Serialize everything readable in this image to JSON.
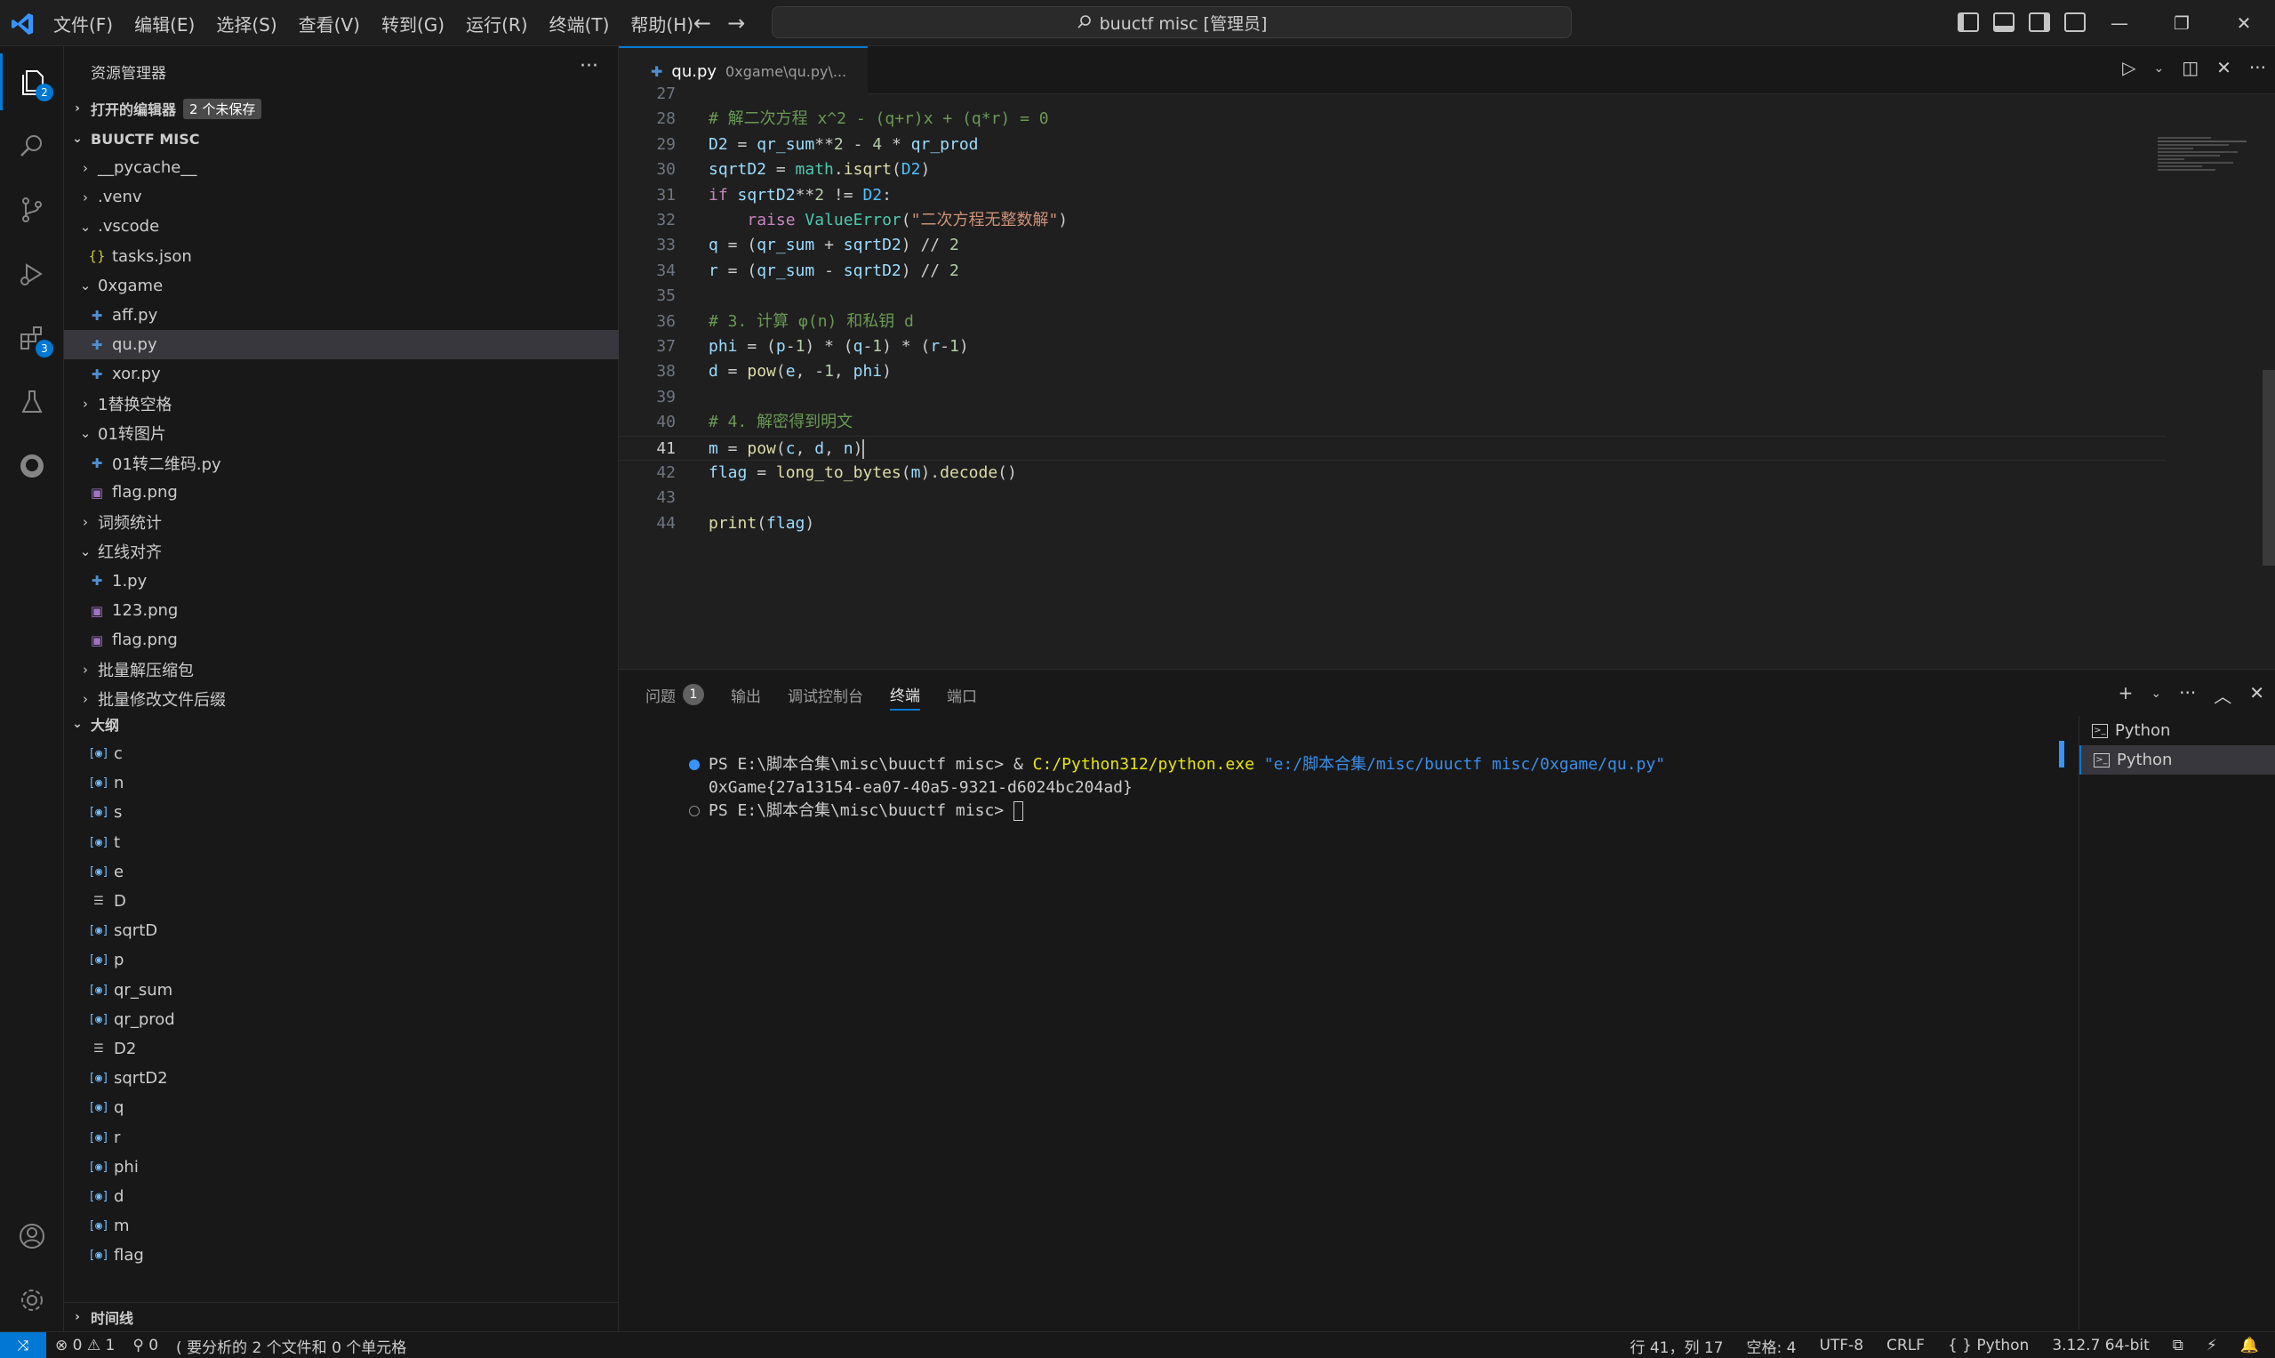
{
  "titlebar": {
    "menu": [
      "文件(F)",
      "编辑(E)",
      "选择(S)",
      "查看(V)",
      "转到(G)",
      "运行(R)",
      "终端(T)",
      "帮助(H)"
    ],
    "search_text": "buuctf misc [管理员]",
    "nav_back": "←",
    "nav_forward": "→"
  },
  "activity": {
    "explorer_badge": "2",
    "extensions_badge": "3"
  },
  "sidebar": {
    "title": "资源管理器",
    "open_editors_label": "打开的编辑器",
    "unsaved_badge": "2 个未保存",
    "workspace_label": "BUUCTF MISC",
    "outline_label": "大纲",
    "timeline_label": "时间线",
    "tree": [
      {
        "label": "__pycache__",
        "kind": "folder",
        "chevron": "›"
      },
      {
        "label": ".venv",
        "kind": "folder",
        "chevron": "›"
      },
      {
        "label": ".vscode",
        "kind": "folder",
        "chevron": "⌄"
      },
      {
        "label": "tasks.json",
        "kind": "json",
        "icon": "{}"
      },
      {
        "label": "0xgame",
        "kind": "folder",
        "chevron": "⌄"
      },
      {
        "label": "aff.py",
        "kind": "py",
        "icon": "✚"
      },
      {
        "label": "qu.py",
        "kind": "py",
        "icon": "✚"
      },
      {
        "label": "xor.py",
        "kind": "py",
        "icon": "✚"
      },
      {
        "label": "1替换空格",
        "kind": "folder",
        "chevron": "›"
      },
      {
        "label": "01转图片",
        "kind": "folder",
        "chevron": "⌄"
      },
      {
        "label": "01转二维码.py",
        "kind": "py",
        "icon": "✚"
      },
      {
        "label": "flag.png",
        "kind": "png",
        "icon": "▣"
      },
      {
        "label": "词频统计",
        "kind": "folder",
        "chevron": "›"
      },
      {
        "label": "红线对齐",
        "kind": "folder",
        "chevron": "⌄"
      },
      {
        "label": "1.py",
        "kind": "py",
        "icon": "✚"
      },
      {
        "label": "123.png",
        "kind": "png",
        "icon": "▣"
      },
      {
        "label": "flag.png",
        "kind": "png",
        "icon": "▣"
      },
      {
        "label": "批量解压缩包",
        "kind": "folder",
        "chevron": "›"
      },
      {
        "label": "批量修改文件后缀",
        "kind": "folder",
        "chevron": "›"
      }
    ],
    "outline": [
      {
        "label": "c",
        "icon": "[◉]"
      },
      {
        "label": "n",
        "icon": "[◉]"
      },
      {
        "label": "s",
        "icon": "[◉]"
      },
      {
        "label": "t",
        "icon": "[◉]"
      },
      {
        "label": "e",
        "icon": "[◉]"
      },
      {
        "label": "D",
        "icon": "☰"
      },
      {
        "label": "sqrtD",
        "icon": "[◉]"
      },
      {
        "label": "p",
        "icon": "[◉]"
      },
      {
        "label": "qr_sum",
        "icon": "[◉]"
      },
      {
        "label": "qr_prod",
        "icon": "[◉]"
      },
      {
        "label": "D2",
        "icon": "☰"
      },
      {
        "label": "sqrtD2",
        "icon": "[◉]"
      },
      {
        "label": "q",
        "icon": "[◉]"
      },
      {
        "label": "r",
        "icon": "[◉]"
      },
      {
        "label": "phi",
        "icon": "[◉]"
      },
      {
        "label": "d",
        "icon": "[◉]"
      },
      {
        "label": "m",
        "icon": "[◉]"
      },
      {
        "label": "flag",
        "icon": "[◉]"
      }
    ]
  },
  "editor": {
    "tab_name": "qu.py",
    "tab_path": "0xgame\\qu.py\\...",
    "lines": [
      {
        "n": "27",
        "html": ""
      },
      {
        "n": "28",
        "html": "<span class=\"cm\"># 解二次方程 x^2 - (q+r)x + (q*r) = 0</span>"
      },
      {
        "n": "29",
        "html": "<span class=\"vr\">D2</span> = <span class=\"vr\">qr_sum</span>**<span class=\"nm\">2</span> - <span class=\"nm\">4</span> * <span class=\"vr\">qr_prod</span>"
      },
      {
        "n": "30",
        "html": "<span class=\"vr\">sqrtD2</span> = <span class=\"ty\">math</span>.<span class=\"fn\">isqrt</span>(<span class=\"cn\">D2</span>)"
      },
      {
        "n": "31",
        "html": "<span class=\"kw\">if</span> <span class=\"vr\">sqrtD2</span>**<span class=\"nm\">2</span> != <span class=\"cn\">D2</span>:"
      },
      {
        "n": "32",
        "html": "    <span class=\"kw\">raise</span> <span class=\"ty\">ValueError</span>(<span class=\"st\">\"二次方程无整数解\"</span>)"
      },
      {
        "n": "33",
        "html": "<span class=\"vr\">q</span> = (<span class=\"vr\">qr_sum</span> + <span class=\"vr\">sqrtD2</span>) // <span class=\"nm\">2</span>"
      },
      {
        "n": "34",
        "html": "<span class=\"vr\">r</span> = (<span class=\"vr\">qr_sum</span> - <span class=\"vr\">sqrtD2</span>) // <span class=\"nm\">2</span>"
      },
      {
        "n": "35",
        "html": ""
      },
      {
        "n": "36",
        "html": "<span class=\"cm\"># 3. 计算 φ(n) 和私钥 d</span>"
      },
      {
        "n": "37",
        "html": "<span class=\"vr\">phi</span> = (<span class=\"vr\">p</span>-<span class=\"nm\">1</span>) * (<span class=\"vr\">q</span>-<span class=\"nm\">1</span>) * (<span class=\"vr\">r</span>-<span class=\"nm\">1</span>)"
      },
      {
        "n": "38",
        "html": "<span class=\"vr\">d</span> = <span class=\"fn\">pow</span>(<span class=\"vr\">e</span>, -<span class=\"nm\">1</span>, <span class=\"vr\">phi</span>)"
      },
      {
        "n": "39",
        "html": ""
      },
      {
        "n": "40",
        "html": "<span class=\"cm\"># 4. 解密得到明文</span>"
      },
      {
        "n": "41",
        "html": "<span class=\"vr\">m</span> = <span class=\"fn\">pow</span>(<span class=\"vr\">c</span>, <span class=\"vr\">d</span>, <span class=\"vr\">n</span>)<span class=\"caret\"></span>"
      },
      {
        "n": "42",
        "html": "<span class=\"vr\">flag</span> = <span class=\"fn\">long_to_bytes</span>(<span class=\"vr\">m</span>).<span class=\"fn\">decode</span>()"
      },
      {
        "n": "43",
        "html": ""
      },
      {
        "n": "44",
        "html": "<span class=\"fn\">print</span>(<span class=\"vr\">flag</span>)"
      }
    ],
    "current_line": "41"
  },
  "panel": {
    "tabs": [
      "问题",
      "输出",
      "调试控制台",
      "终端",
      "端口"
    ],
    "problems_count": "1",
    "active_tab": "终端",
    "terminal_prompt": "PS E:\\脚本合集\\misc\\buuctf misc>",
    "terminal_cmd_amp": "&",
    "terminal_exe": "C:/Python312/python.exe",
    "terminal_arg": "\"e:/脚本合集/misc/buuctf misc/0xgame/qu.py\"",
    "terminal_output": "0xGame{27a13154-ea07-40a5-9321-d6024bc204ad}",
    "terminal_list": [
      "Python",
      "Python"
    ]
  },
  "statusbar": {
    "remote": "⤨",
    "errors": "⊗ 0",
    "warnings": "⚠ 1",
    "ports": "⚲ 0",
    "analysis": "要分析的 2 个文件和 0 个单元格",
    "position": "行 41，列 17",
    "spaces": "空格: 4",
    "encoding": "UTF-8",
    "eol": "CRLF",
    "language": "{ } Python",
    "interpreter": "3.12.7 64-bit"
  }
}
